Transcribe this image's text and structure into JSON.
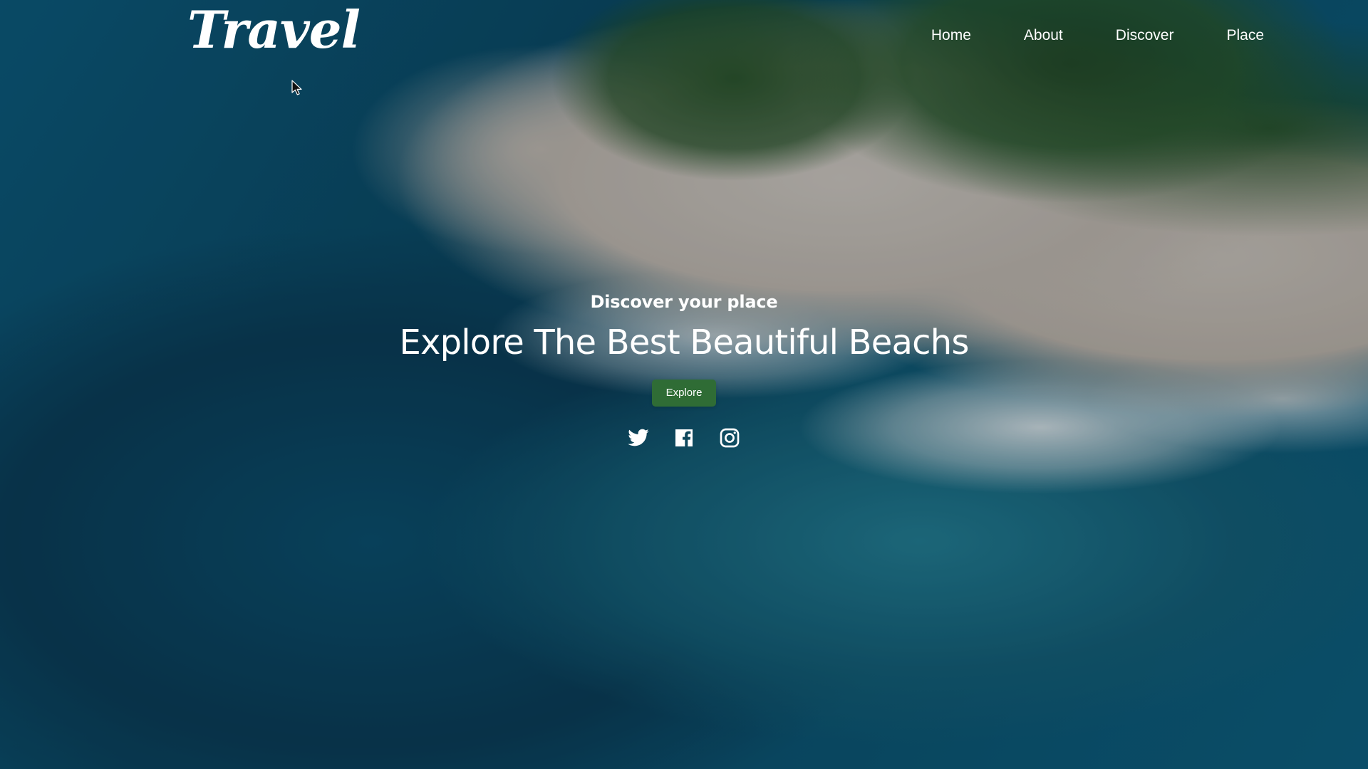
{
  "site": {
    "brand": "Travel"
  },
  "nav": {
    "items": [
      {
        "label": "Home"
      },
      {
        "label": "About"
      },
      {
        "label": "Discover"
      },
      {
        "label": "Place"
      }
    ]
  },
  "hero": {
    "subtitle": "Discover your place",
    "title": "Explore The Best Beautiful Beachs",
    "button": "Explore"
  },
  "social": {
    "icons": [
      {
        "name": "twitter-icon"
      },
      {
        "name": "facebook-icon"
      },
      {
        "name": "instagram-icon"
      }
    ]
  },
  "theme": {
    "button_color": "#2f6c35",
    "text_color": "#ffffff"
  }
}
